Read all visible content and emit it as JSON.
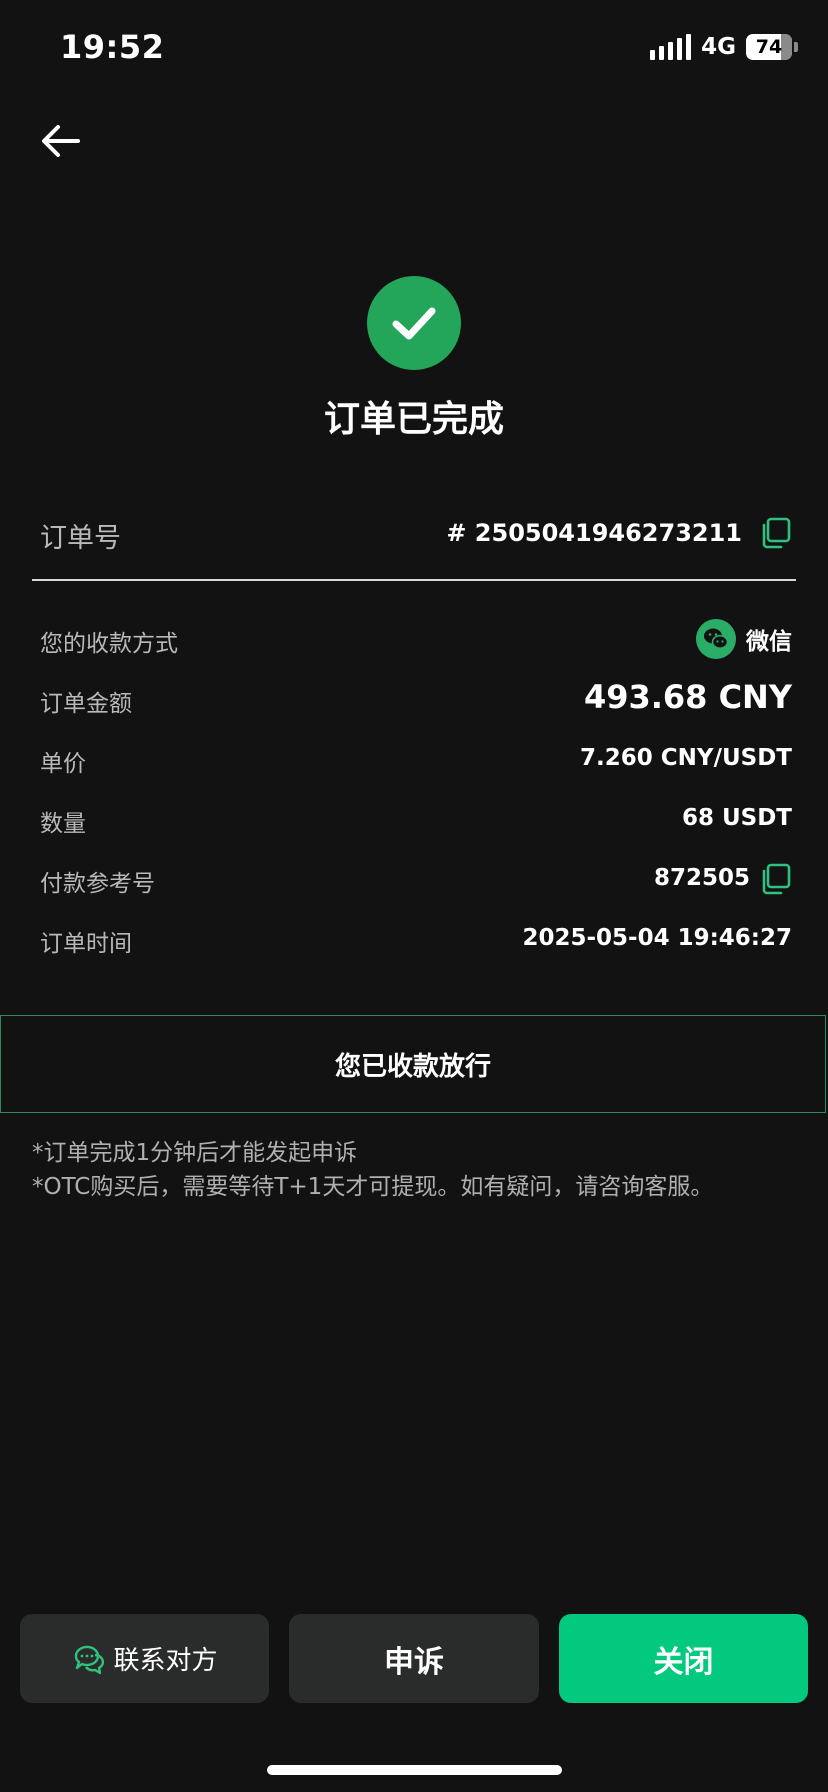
{
  "status_bar": {
    "time": "19:52",
    "network": "4G",
    "battery": "74",
    "battery_level_percent": 74
  },
  "header": {
    "back_icon": "arrow-left-icon"
  },
  "result": {
    "icon": "check-circle-icon",
    "title": "订单已完成",
    "accent_color": "#23a55a"
  },
  "order": {
    "number_label": "订单号",
    "number_value": "# 2505041946273211",
    "details": {
      "payment_method_label": "您的收款方式",
      "payment_method_value": "微信",
      "amount_label": "订单金额",
      "amount_value": "493.68 CNY",
      "price_label": "单价",
      "price_value": "7.260 CNY/USDT",
      "quantity_label": "数量",
      "quantity_value": "68 USDT",
      "reference_label": "付款参考号",
      "reference_value": "872505",
      "time_label": "订单时间",
      "time_value": "2025-05-04 19:46:27"
    }
  },
  "status": {
    "released_text": "您已收款放行"
  },
  "notes": {
    "line1": "*订单完成1分钟后才能发起申诉",
    "line2": "*OTC购买后，需要等待T+1天才可提现。如有疑问，请咨询客服。"
  },
  "actions": {
    "contact_label": "联系对方",
    "appeal_label": "申诉",
    "close_label": "关闭",
    "primary_color": "#02c97d"
  }
}
